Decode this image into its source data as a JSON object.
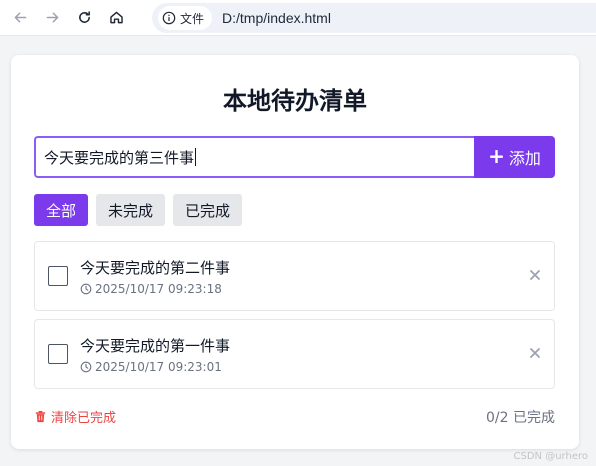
{
  "browser": {
    "info_label": "文件",
    "url": "D:/tmp/index.html",
    "icons": [
      "back-icon",
      "forward-icon",
      "reload-icon",
      "home-icon",
      "info-icon"
    ]
  },
  "app": {
    "title": "本地待办清单",
    "input_value": "今天要完成的第三件事",
    "add_label": "添加",
    "add_icon": "plus",
    "filters": [
      {
        "label": "全部",
        "active": true
      },
      {
        "label": "未完成",
        "active": false
      },
      {
        "label": "已完成",
        "active": false
      }
    ],
    "todos": [
      {
        "text": "今天要完成的第二件事",
        "time": "2025/10/17 09:23:18",
        "done": false
      },
      {
        "text": "今天要完成的第一件事",
        "time": "2025/10/17 09:23:01",
        "done": false
      }
    ],
    "clear_label": "清除已完成",
    "count_label": "0/2 已完成"
  },
  "colors": {
    "accent": "#7c3aed",
    "input_border": "#8b5cf6",
    "danger": "#ef4444",
    "muted": "#6b7280"
  },
  "watermark": "CSDN @urhero"
}
